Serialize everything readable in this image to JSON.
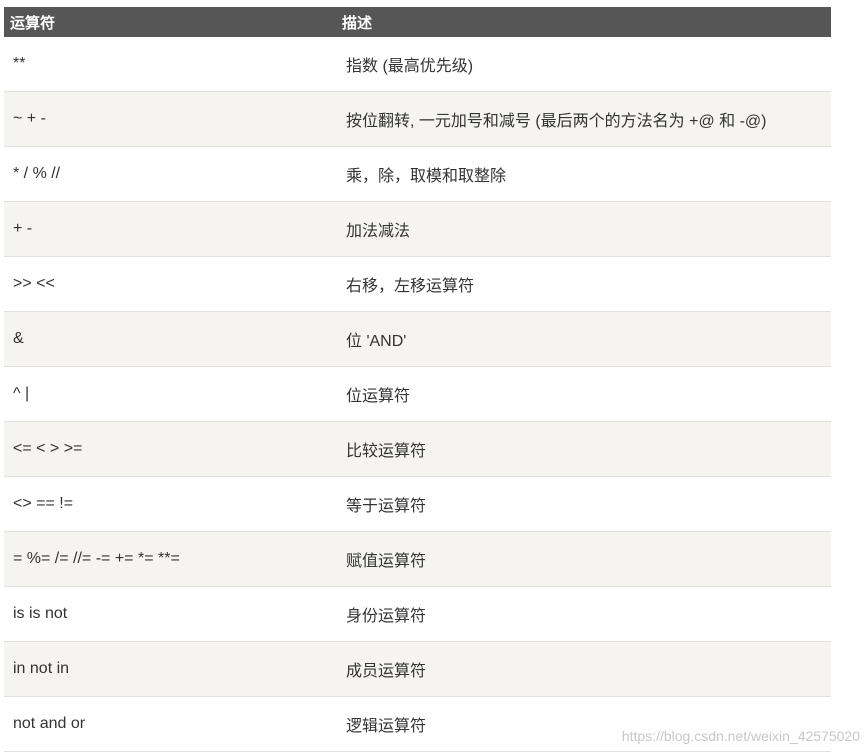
{
  "table": {
    "headers": [
      "运算符",
      "描述"
    ],
    "rows": [
      {
        "op": "**",
        "desc": "指数 (最高优先级)"
      },
      {
        "op": "~ + -",
        "desc": "按位翻转, 一元加号和减号 (最后两个的方法名为 +@ 和 -@)"
      },
      {
        "op": "* / % //",
        "desc": "乘，除，取模和取整除"
      },
      {
        "op": "+ -",
        "desc": "加法减法"
      },
      {
        "op": ">> <<",
        "desc": "右移，左移运算符"
      },
      {
        "op": "&",
        "desc": "位 'AND'"
      },
      {
        "op": "^ |",
        "desc": "位运算符"
      },
      {
        "op": "<= < > >=",
        "desc": "比较运算符"
      },
      {
        "op": "<> == !=",
        "desc": "等于运算符"
      },
      {
        "op": "= %= /= //= -= += *= **=",
        "desc": "赋值运算符"
      },
      {
        "op": "is is not",
        "desc": "身份运算符"
      },
      {
        "op": "in not in",
        "desc": "成员运算符"
      },
      {
        "op": "not and or",
        "desc": "逻辑运算符"
      }
    ]
  },
  "watermark": "https://blog.csdn.net/weixin_42575020"
}
